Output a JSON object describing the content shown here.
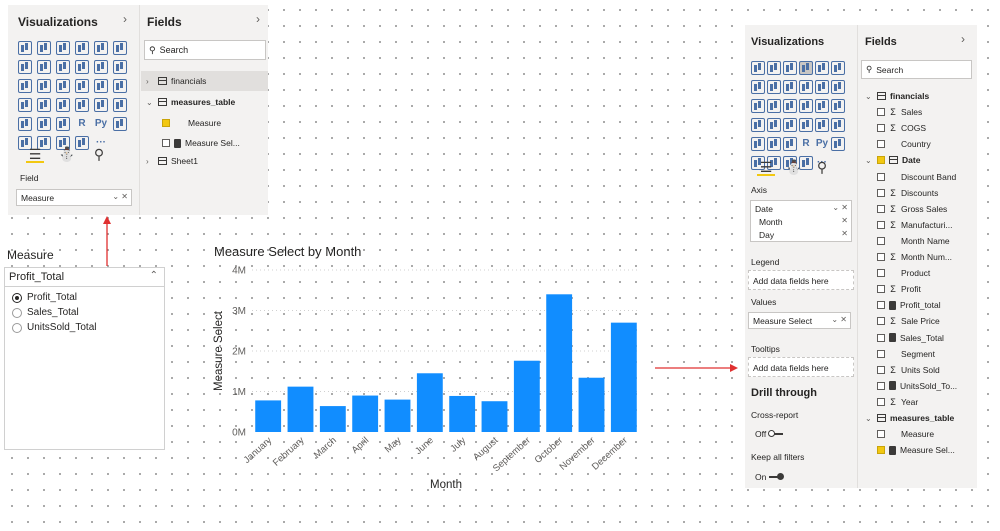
{
  "left_panel": {
    "visualizations_title": "Visualizations",
    "fields_title": "Fields",
    "search_placeholder": "Search",
    "viz_icons_text": {
      "r": "R",
      "py": "Py",
      "more": "···"
    },
    "field_label": "Field",
    "field_value": "Measure",
    "tree": [
      {
        "label": "financials",
        "kind": "table",
        "expanded": false
      },
      {
        "label": "measures_table",
        "kind": "table",
        "expanded": true
      },
      {
        "label": "Measure",
        "kind": "field",
        "checked": true
      },
      {
        "label": "Measure Sel...",
        "kind": "measure",
        "checked": false
      },
      {
        "label": "Sheet1",
        "kind": "table",
        "expanded": false
      }
    ]
  },
  "slicer": {
    "title": "Measure",
    "selected": "Profit_Total",
    "options": [
      {
        "label": "Profit_Total",
        "selected": true
      },
      {
        "label": "Sales_Total",
        "selected": false
      },
      {
        "label": "UnitsSold_Total",
        "selected": false
      }
    ]
  },
  "chart_data": {
    "type": "bar",
    "title": "Measure Select by Month",
    "xlabel": "Month",
    "ylabel": "Measure Select",
    "categories": [
      "January",
      "February",
      "March",
      "April",
      "May",
      "June",
      "July",
      "August",
      "September",
      "October",
      "November",
      "December"
    ],
    "values": [
      0.78,
      1.12,
      0.64,
      0.9,
      0.8,
      1.45,
      0.89,
      0.76,
      1.76,
      3.4,
      1.34,
      2.7
    ],
    "value_unit": "M",
    "ylim": [
      0,
      4
    ],
    "yticks": [
      "0M",
      "1M",
      "2M",
      "3M",
      "4M"
    ],
    "grid": true,
    "color": "#118dff"
  },
  "right_panel": {
    "visualizations_title": "Visualizations",
    "fields_title": "Fields",
    "search_placeholder": "Search",
    "viz_icons_text": {
      "r": "R",
      "py": "Py",
      "more": "···"
    },
    "axis_label": "Axis",
    "axis_fields": [
      "Date",
      "Month",
      "Day"
    ],
    "legend_label": "Legend",
    "legend_placeholder": "Add data fields here",
    "values_label": "Values",
    "values_field": "Measure Select",
    "tooltips_label": "Tooltips",
    "tooltips_placeholder": "Add data fields here",
    "drill_through_title": "Drill through",
    "cross_report_label": "Cross-report",
    "cross_report_state": "Off",
    "keep_filters_label": "Keep all filters",
    "keep_filters_state": "On",
    "tree": [
      {
        "label": "financials",
        "kind": "table",
        "level": 0
      },
      {
        "label": "Sales",
        "kind": "sigma",
        "level": 1,
        "checked": false
      },
      {
        "label": "COGS",
        "kind": "sigma",
        "level": 1,
        "checked": false
      },
      {
        "label": "Country",
        "kind": "plain",
        "level": 1,
        "checked": false
      },
      {
        "label": "Date",
        "kind": "date",
        "level": 1,
        "checked": true,
        "bold": true
      },
      {
        "label": "Discount Band",
        "kind": "plain",
        "level": 1,
        "checked": false
      },
      {
        "label": "Discounts",
        "kind": "sigma",
        "level": 1,
        "checked": false
      },
      {
        "label": "Gross Sales",
        "kind": "sigma",
        "level": 1,
        "checked": false
      },
      {
        "label": "Manufacturi...",
        "kind": "sigma",
        "level": 1,
        "checked": false
      },
      {
        "label": "Month Name",
        "kind": "plain",
        "level": 1,
        "checked": false
      },
      {
        "label": "Month Num...",
        "kind": "sigma",
        "level": 1,
        "checked": false
      },
      {
        "label": "Product",
        "kind": "plain",
        "level": 1,
        "checked": false
      },
      {
        "label": "Profit",
        "kind": "sigma",
        "level": 1,
        "checked": false
      },
      {
        "label": "Profit_total",
        "kind": "measure",
        "level": 1,
        "checked": false
      },
      {
        "label": "Sale Price",
        "kind": "sigma",
        "level": 1,
        "checked": false
      },
      {
        "label": "Sales_Total",
        "kind": "measure",
        "level": 1,
        "checked": false
      },
      {
        "label": "Segment",
        "kind": "plain",
        "level": 1,
        "checked": false
      },
      {
        "label": "Units Sold",
        "kind": "sigma",
        "level": 1,
        "checked": false
      },
      {
        "label": "UnitsSold_To...",
        "kind": "measure",
        "level": 1,
        "checked": false
      },
      {
        "label": "Year",
        "kind": "sigma",
        "level": 1,
        "checked": false
      },
      {
        "label": "measures_table",
        "kind": "table",
        "level": 0
      },
      {
        "label": "Measure",
        "kind": "plain",
        "level": 1,
        "checked": false
      },
      {
        "label": "Measure Sel...",
        "kind": "measure",
        "level": 1,
        "checked": true
      }
    ]
  }
}
